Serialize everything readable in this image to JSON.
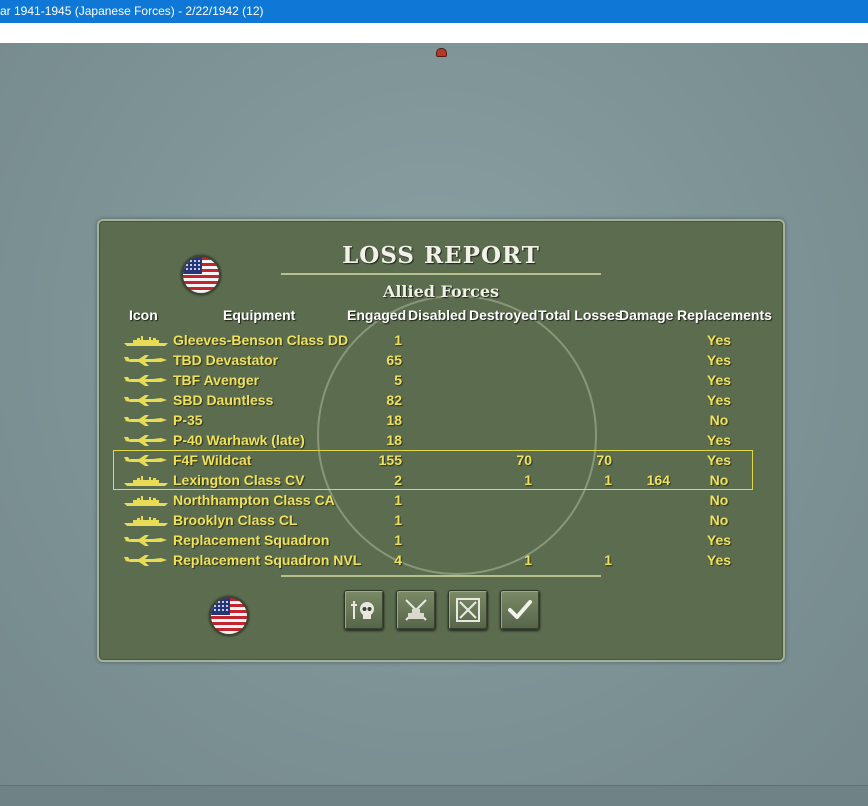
{
  "window": {
    "title": "ar 1941-1945 (Japanese Forces) - 2/22/1942 (12)"
  },
  "report": {
    "title": "LOSS REPORT",
    "subtitle": "Allied Forces"
  },
  "headers": {
    "icon": "Icon",
    "equipment": "Equipment",
    "engaged": "Engaged",
    "disabled": "Disabled",
    "destroyed": "Destroyed",
    "total_losses": "Total Losses",
    "damage": "Damage",
    "replacements": "Replacements"
  },
  "rows": [
    {
      "icon": "ship-icon",
      "equipment": "Gleeves-Benson Class DD",
      "engaged": "1",
      "disabled": "",
      "destroyed": "",
      "total_losses": "",
      "damage": "",
      "replacements": "Yes"
    },
    {
      "icon": "plane-icon",
      "equipment": "TBD Devastator",
      "engaged": "65",
      "disabled": "",
      "destroyed": "",
      "total_losses": "",
      "damage": "",
      "replacements": "Yes"
    },
    {
      "icon": "plane-icon",
      "equipment": "TBF Avenger",
      "engaged": "5",
      "disabled": "",
      "destroyed": "",
      "total_losses": "",
      "damage": "",
      "replacements": "Yes"
    },
    {
      "icon": "plane-icon",
      "equipment": "SBD Dauntless",
      "engaged": "82",
      "disabled": "",
      "destroyed": "",
      "total_losses": "",
      "damage": "",
      "replacements": "Yes"
    },
    {
      "icon": "plane-icon",
      "equipment": "P-35",
      "engaged": "18",
      "disabled": "",
      "destroyed": "",
      "total_losses": "",
      "damage": "",
      "replacements": "No"
    },
    {
      "icon": "plane-icon",
      "equipment": "P-40 Warhawk (late)",
      "engaged": "18",
      "disabled": "",
      "destroyed": "",
      "total_losses": "",
      "damage": "",
      "replacements": "Yes"
    },
    {
      "icon": "plane-icon",
      "equipment": "F4F Wildcat",
      "engaged": "155",
      "disabled": "",
      "destroyed": "70",
      "total_losses": "70",
      "damage": "",
      "replacements": "Yes"
    },
    {
      "icon": "ship-icon",
      "equipment": "Lexington Class CV",
      "engaged": "2",
      "disabled": "",
      "destroyed": "1",
      "total_losses": "1",
      "damage": "164",
      "replacements": "No"
    },
    {
      "icon": "ship-icon",
      "equipment": "Northhampton Class CA",
      "engaged": "1",
      "disabled": "",
      "destroyed": "",
      "total_losses": "",
      "damage": "",
      "replacements": "No"
    },
    {
      "icon": "ship-icon",
      "equipment": "Brooklyn Class CL",
      "engaged": "1",
      "disabled": "",
      "destroyed": "",
      "total_losses": "",
      "damage": "",
      "replacements": "No"
    },
    {
      "icon": "plane-icon",
      "equipment": "Replacement Squadron",
      "engaged": "1",
      "disabled": "",
      "destroyed": "",
      "total_losses": "",
      "damage": "",
      "replacements": "Yes"
    },
    {
      "icon": "plane-icon",
      "equipment": "Replacement Squadron NVL",
      "engaged": "4",
      "disabled": "",
      "destroyed": "1",
      "total_losses": "1",
      "damage": "",
      "replacements": "Yes"
    }
  ],
  "buttons": [
    {
      "name": "casualties-button",
      "icon": "skull-icon"
    },
    {
      "name": "disabled-units-button",
      "icon": "crossed-swords-tank-icon"
    },
    {
      "name": "destroyed-units-button",
      "icon": "crossed-swords-box-icon"
    },
    {
      "name": "confirm-button",
      "icon": "checkmark-icon"
    }
  ],
  "colors": {
    "panel": "#5c6d4f",
    "row_text": "#efe25a",
    "header_text": "#ffffff",
    "titlebar": "#0f78d7"
  }
}
